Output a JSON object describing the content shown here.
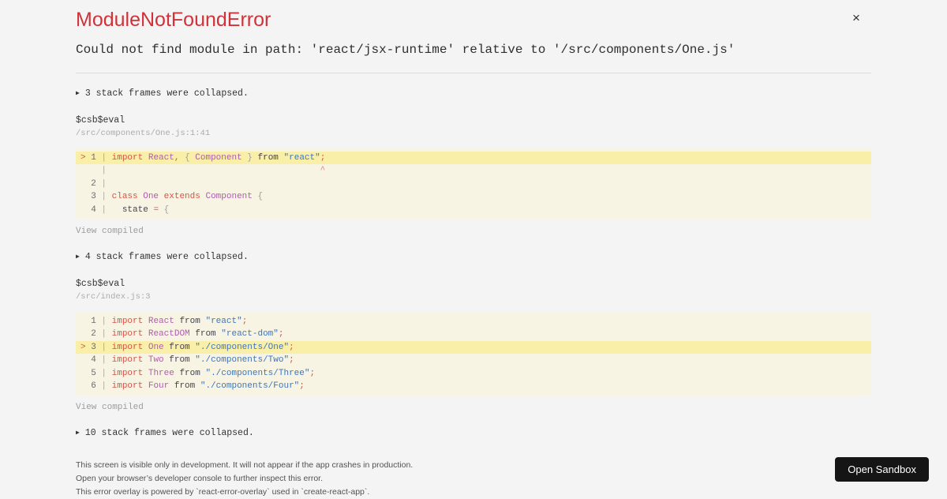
{
  "colors": {
    "page_bg": "#f4f4f4",
    "title": "#d13239",
    "code_bg": "#f8f4e3",
    "code_hl": "#faefa8",
    "tok_keyword": "#d65348",
    "tok_cap": "#ae5cae",
    "tok_str": "#3e75ba",
    "tok_plain": "#44434f",
    "tok_punct": "#9e9e9e",
    "tok_caret": "#de8a80",
    "button_bg": "#151515",
    "button_text": "#ffffff"
  },
  "header": {
    "title": "ModuleNotFoundError",
    "message": "Could not find module in path: 'react/jsx-runtime' relative to '/src/components/One.js'",
    "close": "×"
  },
  "stack": {
    "triangle": "▶",
    "collapsed1": "3 stack frames were collapsed.",
    "collapsed2": "4 stack frames were collapsed.",
    "collapsed3": "10 stack frames were collapsed.",
    "view_compiled": "View compiled",
    "frame1_fn": "$csb$eval",
    "frame1_loc": "/src/components/One.js:1:41",
    "frame2_fn": "$csb$eval",
    "frame2_loc": "/src/index.js:3"
  },
  "code_blocks": [
    {
      "lines": [
        {
          "marker": ">",
          "num": "1",
          "hl": true,
          "tokens": [
            [
              "k",
              "import "
            ],
            [
              "cap",
              "React"
            ],
            [
              "k",
              ", "
            ],
            [
              "p",
              "{ "
            ],
            [
              "cap",
              "Component"
            ],
            [
              "p",
              " } "
            ],
            [
              "t",
              "from "
            ],
            [
              "str",
              "\"react\""
            ],
            [
              "k",
              ";"
            ]
          ]
        },
        {
          "marker": " ",
          "num": " ",
          "hl": false,
          "tokens": [
            [
              "caret",
              "                                        ^"
            ]
          ]
        },
        {
          "marker": " ",
          "num": "2",
          "hl": false,
          "tokens": []
        },
        {
          "marker": " ",
          "num": "3",
          "hl": false,
          "tokens": [
            [
              "k",
              "class "
            ],
            [
              "cap",
              "One"
            ],
            [
              "k",
              " extends "
            ],
            [
              "cap",
              "Component"
            ],
            [
              "p",
              " {"
            ]
          ]
        },
        {
          "marker": " ",
          "num": "4",
          "hl": false,
          "tokens": [
            [
              "t",
              "  state "
            ],
            [
              "k",
              "="
            ],
            [
              "p",
              " {"
            ]
          ]
        }
      ]
    },
    {
      "lines": [
        {
          "marker": " ",
          "num": "1",
          "hl": false,
          "tokens": [
            [
              "k",
              "import "
            ],
            [
              "cap",
              "React"
            ],
            [
              "t",
              " from "
            ],
            [
              "str",
              "\"react\""
            ],
            [
              "k",
              ";"
            ]
          ]
        },
        {
          "marker": " ",
          "num": "2",
          "hl": false,
          "tokens": [
            [
              "k",
              "import "
            ],
            [
              "cap",
              "ReactDOM"
            ],
            [
              "t",
              " from "
            ],
            [
              "str",
              "\"react-dom\""
            ],
            [
              "k",
              ";"
            ]
          ]
        },
        {
          "marker": ">",
          "num": "3",
          "hl": true,
          "tokens": [
            [
              "k",
              "import "
            ],
            [
              "cap",
              "One"
            ],
            [
              "t",
              " from "
            ],
            [
              "str",
              "\"./components/One\""
            ],
            [
              "k",
              ";"
            ]
          ]
        },
        {
          "marker": " ",
          "num": "4",
          "hl": false,
          "tokens": [
            [
              "k",
              "import "
            ],
            [
              "cap",
              "Two"
            ],
            [
              "t",
              " from "
            ],
            [
              "str",
              "\"./components/Two\""
            ],
            [
              "k",
              ";"
            ]
          ]
        },
        {
          "marker": " ",
          "num": "5",
          "hl": false,
          "tokens": [
            [
              "k",
              "import "
            ],
            [
              "cap",
              "Three"
            ],
            [
              "t",
              " from "
            ],
            [
              "str",
              "\"./components/Three\""
            ],
            [
              "k",
              ";"
            ]
          ]
        },
        {
          "marker": " ",
          "num": "6",
          "hl": false,
          "tokens": [
            [
              "k",
              "import "
            ],
            [
              "cap",
              "Four"
            ],
            [
              "t",
              " from "
            ],
            [
              "str",
              "\"./components/Four\""
            ],
            [
              "k",
              ";"
            ]
          ]
        }
      ]
    }
  ],
  "footer": {
    "line1": "This screen is visible only in development. It will not appear if the app crashes in production.",
    "line2": "Open your browser’s developer console to further inspect this error.",
    "line3": "This error overlay is powered by `react-error-overlay` used in `create-react-app`.",
    "open_sandbox": "Open Sandbox"
  }
}
